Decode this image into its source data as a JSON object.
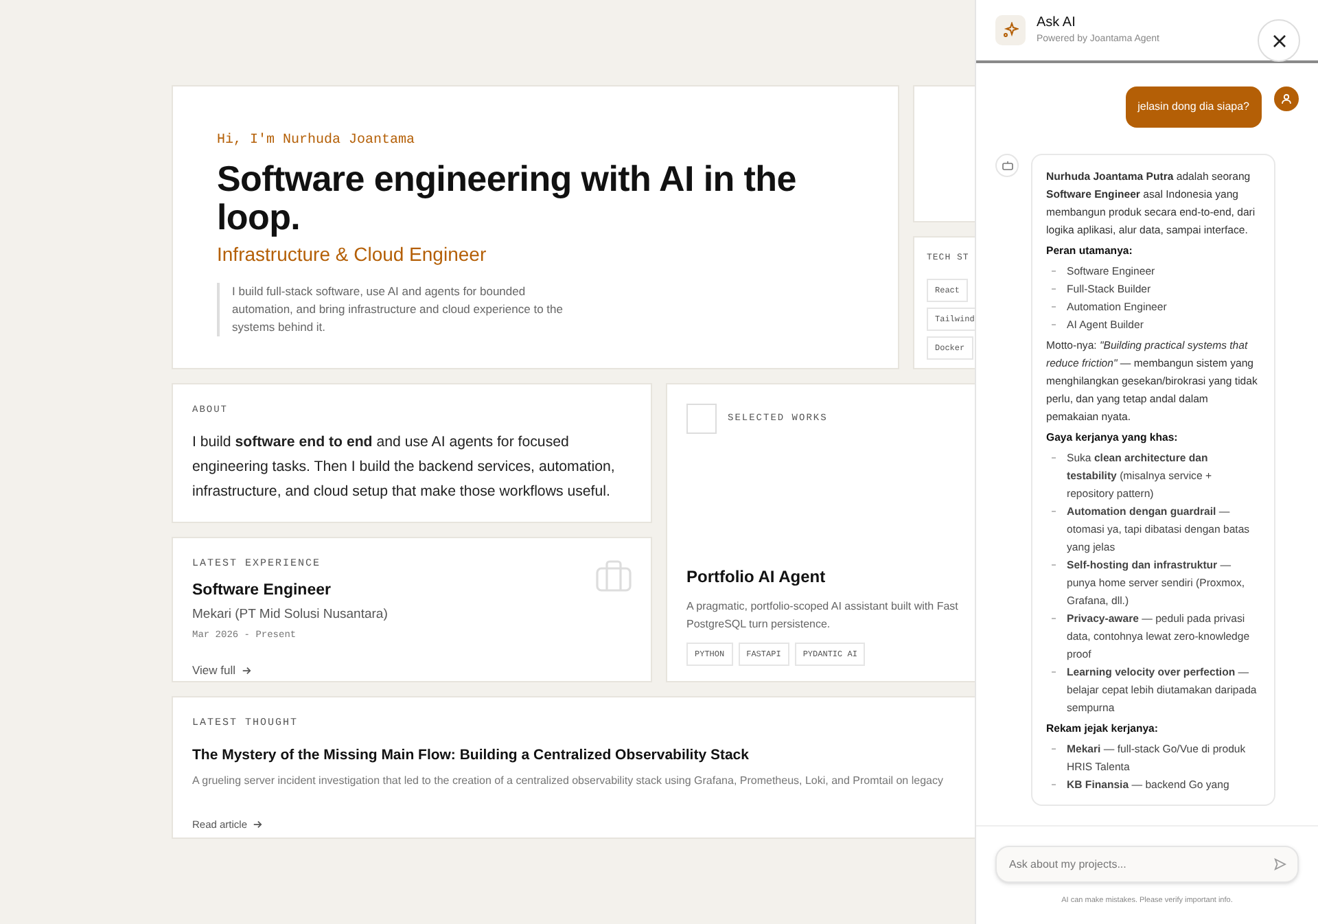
{
  "hero": {
    "greeting": "Hi, I'm Nurhuda Joantama",
    "title": "Software engineering with AI in the loop.",
    "subtitle": "Infrastructure & Cloud Engineer",
    "intro": "I build full-stack software, use AI and agents for bounded automation, and bring infrastructure and cloud experience to the systems behind it."
  },
  "tech_stack": {
    "heading": "TECH ST",
    "tags": [
      "React",
      "Tailwind",
      "Docker"
    ]
  },
  "about": {
    "heading": "ABOUT",
    "text": "I build **software end to end** and use AI agents for focused engineering tasks. Then I build the backend services, automation, infrastructure, and cloud setup that make those workflows useful."
  },
  "experience": {
    "heading": "LATEST EXPERIENCE",
    "role": "Software Engineer",
    "company": "Mekari (PT Mid Solusi Nusantara)",
    "period": "Mar 2026 - Present",
    "link": "View full"
  },
  "selected_works": {
    "heading": "SELECTED WORKS",
    "title": "Portfolio AI Agent",
    "description_lines": [
      "A pragmatic, portfolio-scoped AI assistant built with Fast",
      "PostgreSQL turn persistence."
    ],
    "tags": [
      "PYTHON",
      "FASTAPI",
      "PYDANTIC AI"
    ]
  },
  "thought": {
    "heading": "LATEST THOUGHT",
    "title": "The Mystery of the Missing Main Flow: Building a Centralized Observability Stack",
    "summary": "A grueling server incident investigation that led to the creation of a centralized observability stack using Grafana, Prometheus, Loki, and Promtail on legacy",
    "link": "Read article"
  },
  "chat": {
    "title": "Ask AI",
    "subtitle": "Powered by Joantama Agent",
    "messages": [
      {
        "kind": "user",
        "text": "jelasin dong dia siapa?"
      },
      {
        "kind": "assistant",
        "blocks": [
          {
            "kind": "paragraph",
            "text": "**Nurhuda Joantama Putra** adalah seorang **Software Engineer** asal Indonesia yang membangun produk secara end-to-end, dari logika aplikasi, alur data, sampai interface."
          },
          {
            "kind": "heading",
            "text": "Peran utamanya:"
          },
          {
            "kind": "list",
            "items": [
              "Software Engineer",
              "Full-Stack Builder",
              "Automation Engineer",
              "AI Agent Builder"
            ]
          },
          {
            "kind": "paragraph",
            "text": "Motto-nya: *\"Building practical systems that reduce friction\"* — membangun sistem yang menghilangkan gesekan/birokrasi yang tidak perlu, dan yang tetap andal dalam pemakaian nyata."
          },
          {
            "kind": "heading",
            "text": "Gaya kerjanya yang khas:"
          },
          {
            "kind": "list",
            "items": [
              "Suka **clean architecture dan testability** (misalnya service + repository pattern)",
              "**Automation dengan guardrail** — otomasi ya, tapi dibatasi dengan batas yang jelas",
              "**Self-hosting dan infrastruktur** — punya home server sendiri (Proxmox, Grafana, dll.)",
              "**Privacy-aware** — peduli pada privasi data, contohnya lewat zero-knowledge proof",
              "**Learning velocity over perfection** — belajar cepat lebih diutamakan daripada sempurna"
            ]
          },
          {
            "kind": "heading",
            "text": "Rekam jejak kerjanya:"
          },
          {
            "kind": "list",
            "items": [
              "**Mekari** — full-stack Go/Vue di produk HRIS Talenta",
              "**KB Finansia** — backend Go yang"
            ]
          }
        ]
      }
    ],
    "input": {
      "placeholder": "Ask about my projects..."
    },
    "disclaimer": "AI can make mistakes. Please verify important info."
  }
}
